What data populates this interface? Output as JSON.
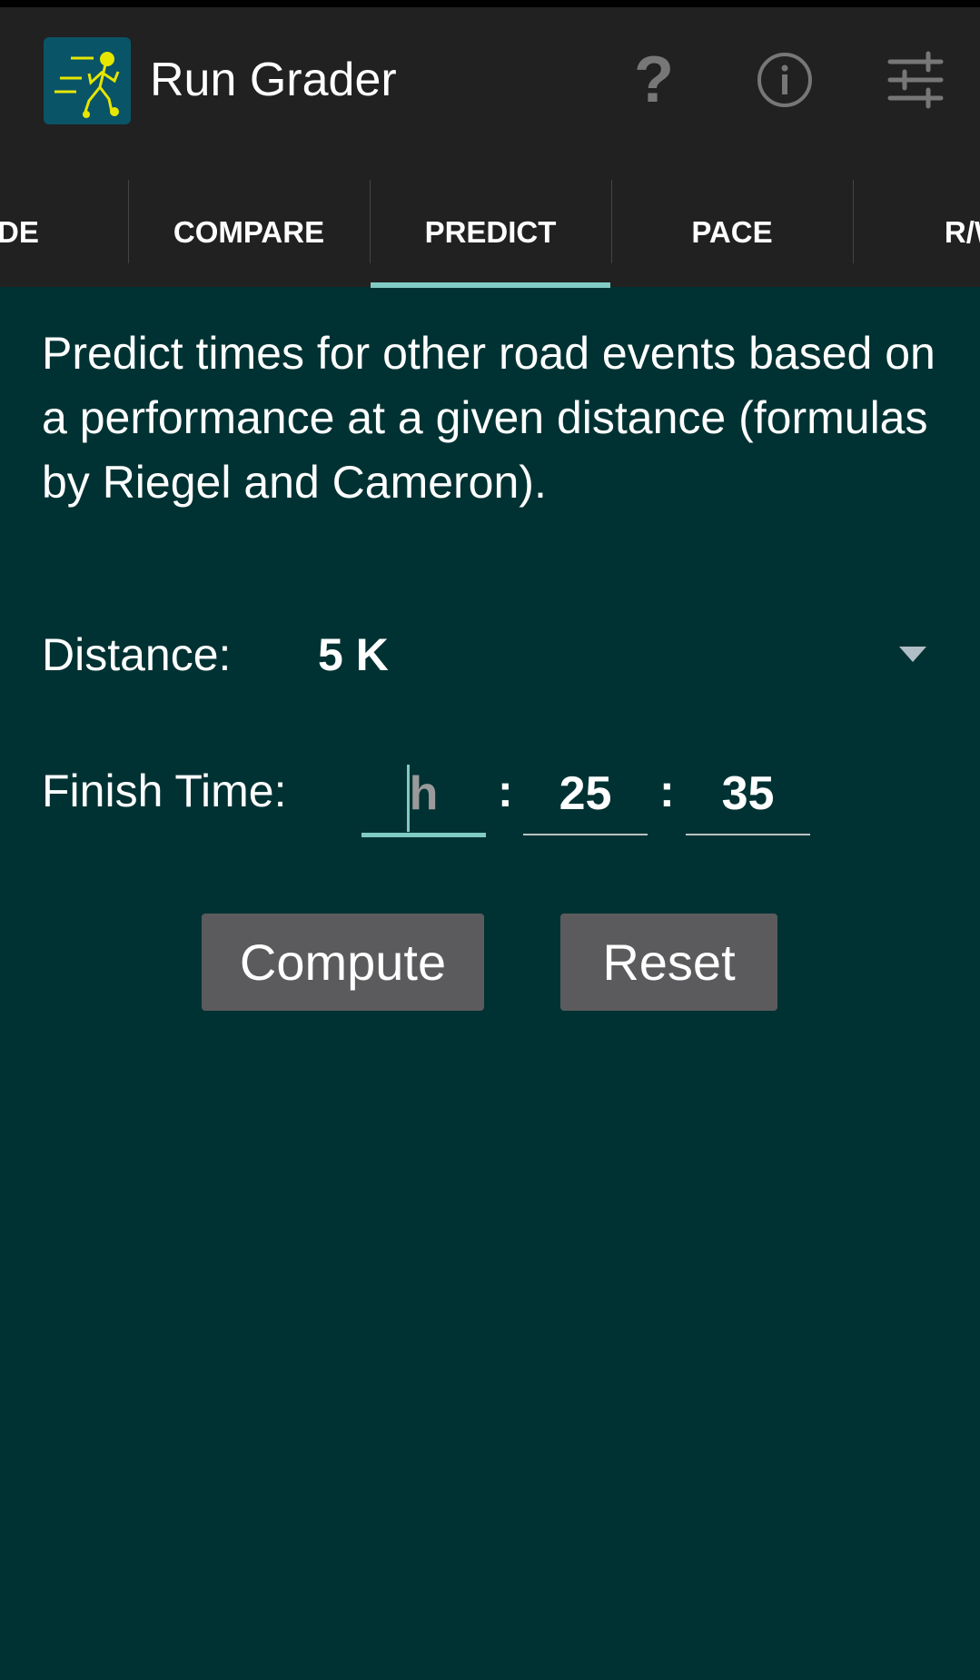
{
  "app": {
    "title": "Run Grader",
    "accent_color": "#80cbc4",
    "background_color": "#013233"
  },
  "appbar": {
    "icons": [
      "help-icon",
      "info-icon",
      "settings-sliders-icon"
    ]
  },
  "tabs": [
    {
      "label": "ADE"
    },
    {
      "label": "COMPARE"
    },
    {
      "label": "PREDICT",
      "selected": true
    },
    {
      "label": "PACE"
    },
    {
      "label": "R/W"
    }
  ],
  "main": {
    "description": "Predict times for other road events based on a performance at a given distance (formulas by Riegel and Cameron).",
    "distance_label": "Distance:",
    "distance_value": "5 K",
    "finish_time_label": "Finish Time:",
    "hours_placeholder": "h",
    "hours_value": "",
    "minutes_value": "25",
    "seconds_value": "35",
    "separator": ":",
    "compute_label": "Compute",
    "reset_label": "Reset"
  }
}
